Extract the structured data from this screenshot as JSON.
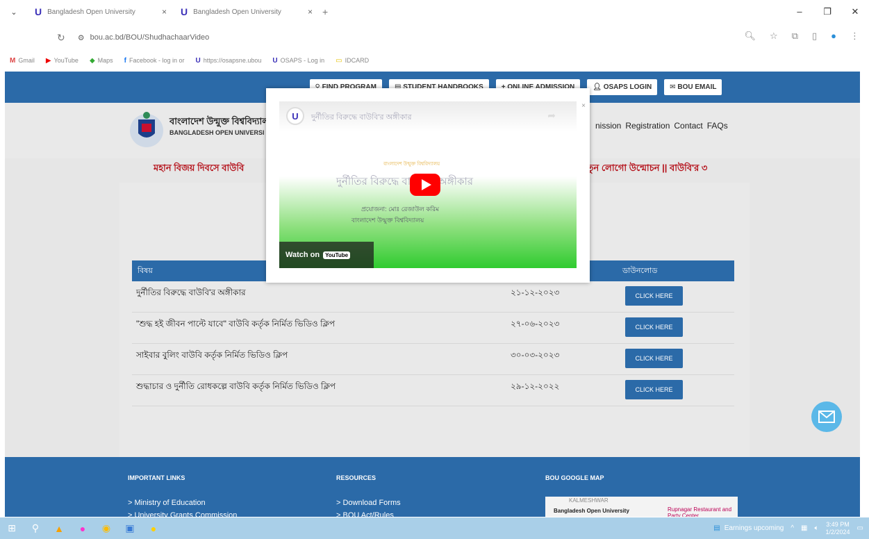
{
  "browser": {
    "tabs": [
      {
        "title": "Bangladesh Open University"
      },
      {
        "title": "Bangladesh Open University"
      }
    ],
    "url": "bou.ac.bd/BOU/ShudhachaarVideo",
    "bookmarks": [
      "Gmail",
      "YouTube",
      "Maps",
      "Facebook - log in or",
      "https://osapsne.ubou",
      "OSAPS - Log in",
      "IDCARD"
    ]
  },
  "nav": {
    "buttons": [
      "FIND PROGRAM",
      "STUDENT HANDBOOKS",
      "+ ONLINE ADMISSION",
      "OSAPS LOGIN",
      "BOU EMAIL"
    ]
  },
  "header": {
    "name_bn": "বাংলাদেশ উন্মুক্ত বিশ্ববিদ্যাল",
    "name_en": "BANGLADESH OPEN UNIVERSI",
    "menu": [
      "nission",
      "Registration",
      "Contact",
      "FAQs"
    ]
  },
  "marquee": {
    "left": "মহান বিজয় দিবসে বাউবি",
    "right": "নতুন লোগো উন্মোচন  ||  বাউবি'র ৩"
  },
  "table": {
    "col_subject": "বিষয়",
    "col_download": "ডাউনলোড",
    "rows": [
      {
        "subject": "দুর্নীতির বিরুদ্ধে বাউবি'র অঙ্গীকার",
        "date": "২১-১২-২০২৩",
        "button": "CLICK HERE"
      },
      {
        "subject": "\"শুদ্ধ হই জীবন পাল্টে যাবে\" বাউবি কর্তৃক নির্মিত ভিডিও ক্লিপ",
        "date": "২৭-০৬-২০২৩",
        "button": "CLICK HERE"
      },
      {
        "subject": "সাইবার বুলিং বাউবি কর্তৃক নির্মিত ভিডিও ক্লিপ",
        "date": "৩০-০৩-২০২৩",
        "button": "CLICK HERE"
      },
      {
        "subject": "শুদ্ধাচার ও দুর্নীতি রোধকল্পে বাউবি কর্তৃক নির্মিত ভিডিও ক্লিপ",
        "date": "২৯-১২-২০২২",
        "button": "CLICK HERE"
      }
    ]
  },
  "footer": {
    "col1_title": "IMPORTANT LINKS",
    "col1_items": [
      "> Ministry of Education",
      "> University Grants Commission"
    ],
    "col2_title": "RESOURCES",
    "col2_items": [
      "> Download Forms",
      "> BOU Act/Rules"
    ],
    "col3_title": "BOU GOOGLE MAP",
    "map_label": "Bangladesh Open University",
    "map_place": "Rupnagar Restaurant and Party Center",
    "map_area": "KALMESHWAR"
  },
  "video": {
    "title": "দুর্নীতির বিরুদ্ধে বাউবি'র অঙ্গীকার",
    "line1": "বাংলাদেশ উন্মুক্ত বিশ্ববিদ্যালয়",
    "line2": "দুর্নীতির বিরুদ্ধে বাউবি'র অঙ্গীকার",
    "line3": "প্রযোজনা: মোঃ রেজাউল করিম",
    "line4": "বাংলাদেশ উন্মুক্ত বিশ্ববিদ্যালয়",
    "watch_on": "Watch on",
    "yt": "YouTube"
  },
  "taskbar": {
    "news": "Earnings upcoming",
    "time": "3:49 PM",
    "date": "1/2/2024"
  },
  "colors": {
    "brand_blue": "#2b6aa8",
    "alert_red": "#b5121b"
  }
}
